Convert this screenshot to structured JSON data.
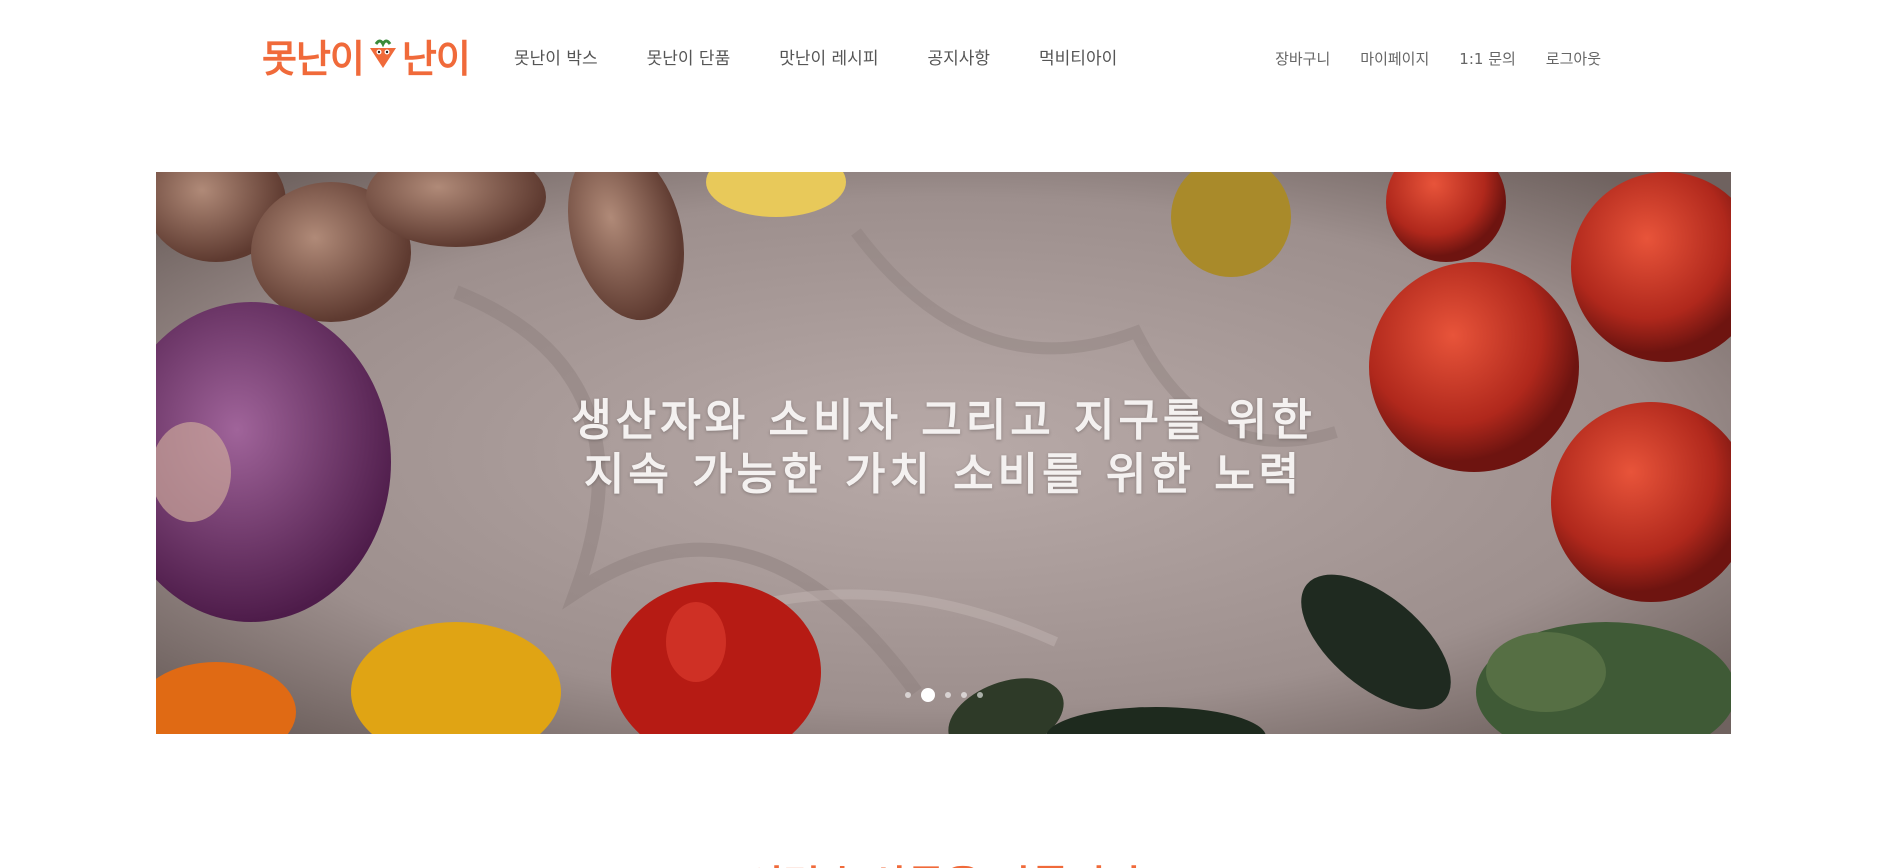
{
  "header": {
    "logo_text_left": "못난이",
    "logo_text_right": "난이",
    "logo_color": "#f06a3a",
    "nav_main": [
      {
        "label": "못난이 박스"
      },
      {
        "label": "못난이 단품"
      },
      {
        "label": "맛난이 레시피"
      },
      {
        "label": "공지사항"
      },
      {
        "label": "먹비티아이"
      }
    ],
    "nav_user": [
      {
        "label": "장바구니"
      },
      {
        "label": "마이페이지"
      },
      {
        "label": "1:1 문의"
      },
      {
        "label": "로그아웃"
      }
    ]
  },
  "banner": {
    "line1": "생산자와 소비자 그리고 지구를 위한",
    "line2": "지속 가능한 가치 소비를 위한 노력",
    "slide_count": 5,
    "active_slide": 2
  },
  "section": {
    "title": "이런 농산물을 다룹니다",
    "title_color": "#f06a3a"
  }
}
